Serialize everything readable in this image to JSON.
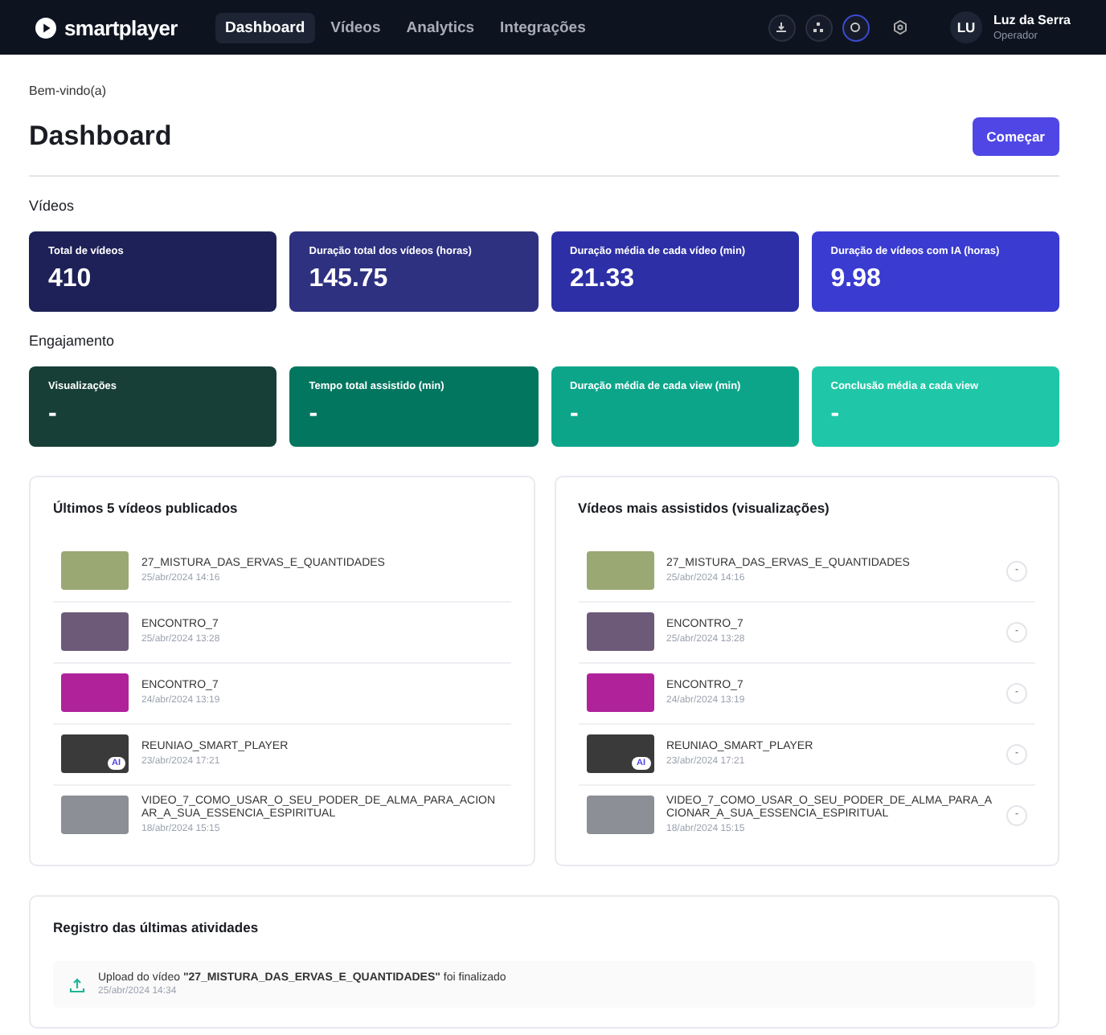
{
  "header": {
    "brand": "smartplayer",
    "nav": [
      {
        "label": "Dashboard",
        "selected": true
      },
      {
        "label": "Vídeos",
        "selected": false
      },
      {
        "label": "Analytics",
        "selected": false
      },
      {
        "label": "Integrações",
        "selected": false
      }
    ],
    "user": {
      "initials": "LU",
      "name": "Luz da Serra",
      "role": "Operador"
    }
  },
  "greeting": "Bem-vindo(a)",
  "title": "Dashboard",
  "start_button": "Começar",
  "sections": [
    {
      "heading": "Vídeos",
      "stats": [
        {
          "label": "Total de vídeos",
          "value": "410",
          "color": "#1e2157"
        },
        {
          "label": "Duração total dos vídeos (horas)",
          "value": "145.75",
          "color": "#2e3080"
        },
        {
          "label": "Duração média de cada vídeo (min)",
          "value": "21.33",
          "color": "#2d2fa6"
        },
        {
          "label": "Duração de vídeos com IA (horas)",
          "value": "9.98",
          "color": "#3a3bd0"
        }
      ]
    },
    {
      "heading": "Engajamento",
      "stats": [
        {
          "label": "Visualizações",
          "value": "-",
          "color": "#173f37"
        },
        {
          "label": "Tempo total assistido (min)",
          "value": "-",
          "color": "#037660"
        },
        {
          "label": "Duração média de cada view (min)",
          "value": "-",
          "color": "#0ca58a"
        },
        {
          "label": "Conclusão média a cada view",
          "value": "-",
          "color": "#1fc7a8"
        }
      ]
    }
  ],
  "panels": [
    {
      "title": "Últimos 5 vídeos publicados",
      "videos": [
        {
          "name": "27_MISTURA_DAS_ERVAS_E_QUANTIDADES",
          "date": "25/abr/2024 14:16",
          "color": "#9aa873"
        },
        {
          "name": "ENCONTRO_7",
          "date": "25/abr/2024 13:28",
          "color": "#6d5a78"
        },
        {
          "name": "ENCONTRO_7",
          "date": "24/abr/2024 13:19",
          "color": "#b0229a"
        },
        {
          "name": "REUNIAO_SMART_PLAYER",
          "date": "23/abr/2024 17:21",
          "color": "#3a3a3a",
          "badge": "AI"
        },
        {
          "name": "VIDEO_7_COMO_USAR_O_SEU_PODER_DE_ALMA_PARA_ACIONAR_A_SUA_ESSENCIA_ESPIRITUAL",
          "date": "18/abr/2024 15:15",
          "color": "#8c8f96"
        }
      ]
    },
    {
      "title": "Vídeos mais assistidos (visualizações)",
      "videos": [
        {
          "name": "27_MISTURA_DAS_ERVAS_E_QUANTIDADES",
          "date": "25/abr/2024 14:16",
          "color": "#9aa873",
          "views": "-"
        },
        {
          "name": "ENCONTRO_7",
          "date": "25/abr/2024 13:28",
          "color": "#6d5a78",
          "views": "-"
        },
        {
          "name": "ENCONTRO_7",
          "date": "24/abr/2024 13:19",
          "color": "#b0229a",
          "views": "-"
        },
        {
          "name": "REUNIAO_SMART_PLAYER",
          "date": "23/abr/2024 17:21",
          "color": "#3a3a3a",
          "badge": "AI",
          "views": "-"
        },
        {
          "name": "VIDEO_7_COMO_USAR_O_SEU_PODER_DE_ALMA_PARA_ACIONAR_A_SUA_ESSENCIA_ESPIRITUAL",
          "date": "18/abr/2024 15:15",
          "color": "#8c8f96",
          "views": "-"
        }
      ]
    }
  ],
  "activity": {
    "title": "Registro das últimas atividades",
    "items": [
      {
        "text": "Upload do vídeo  **\"27_MISTURA_DAS_ERVAS_E_QUANTIDADES\"**  foi finalizado",
        "date": "25/abr/2024 14:34"
      }
    ]
  }
}
